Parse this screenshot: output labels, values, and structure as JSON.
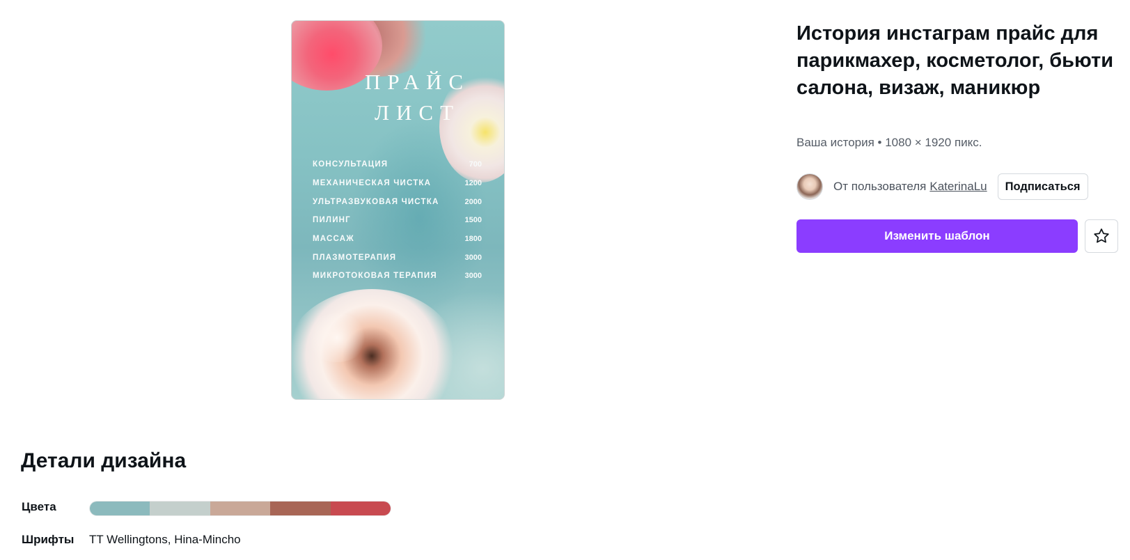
{
  "preview": {
    "title": "ПРАЙС\nЛИСТ",
    "items": [
      {
        "name": "КОНСУЛЬТАЦИЯ",
        "price": "700"
      },
      {
        "name": "МЕХАНИЧЕСКАЯ ЧИСТКА",
        "price": "1200"
      },
      {
        "name": "УЛЬТРАЗВУКОВАЯ ЧИСТКА",
        "price": "2000"
      },
      {
        "name": "ПИЛИНГ",
        "price": "1500"
      },
      {
        "name": "МАССАЖ",
        "price": "1800"
      },
      {
        "name": "ПЛАЗМОТЕРАПИЯ",
        "price": "3000"
      },
      {
        "name": "МИКРОТОКОВАЯ ТЕРАПИЯ",
        "price": "3000"
      }
    ]
  },
  "template": {
    "title": "История инстаграм прайс для парикмахер, косметолог, бьюти салона, визаж, маникюр",
    "subtitle": "Ваша история • 1080 × 1920 пикс.",
    "author_prefix": "От пользователя",
    "author_name": "KaterinaLu",
    "subscribe_label": "Подписаться",
    "edit_label": "Изменить шаблон"
  },
  "details": {
    "heading": "Детали дизайна",
    "colors_label": "Цвета",
    "colors": [
      "#8cbabd",
      "#c4cfcc",
      "#c9a898",
      "#a86656",
      "#c84a50"
    ],
    "fonts_label": "Шрифты",
    "fonts_value": "TT Wellingtons, Hina-Mincho"
  },
  "accent_color": "#8b3dff"
}
